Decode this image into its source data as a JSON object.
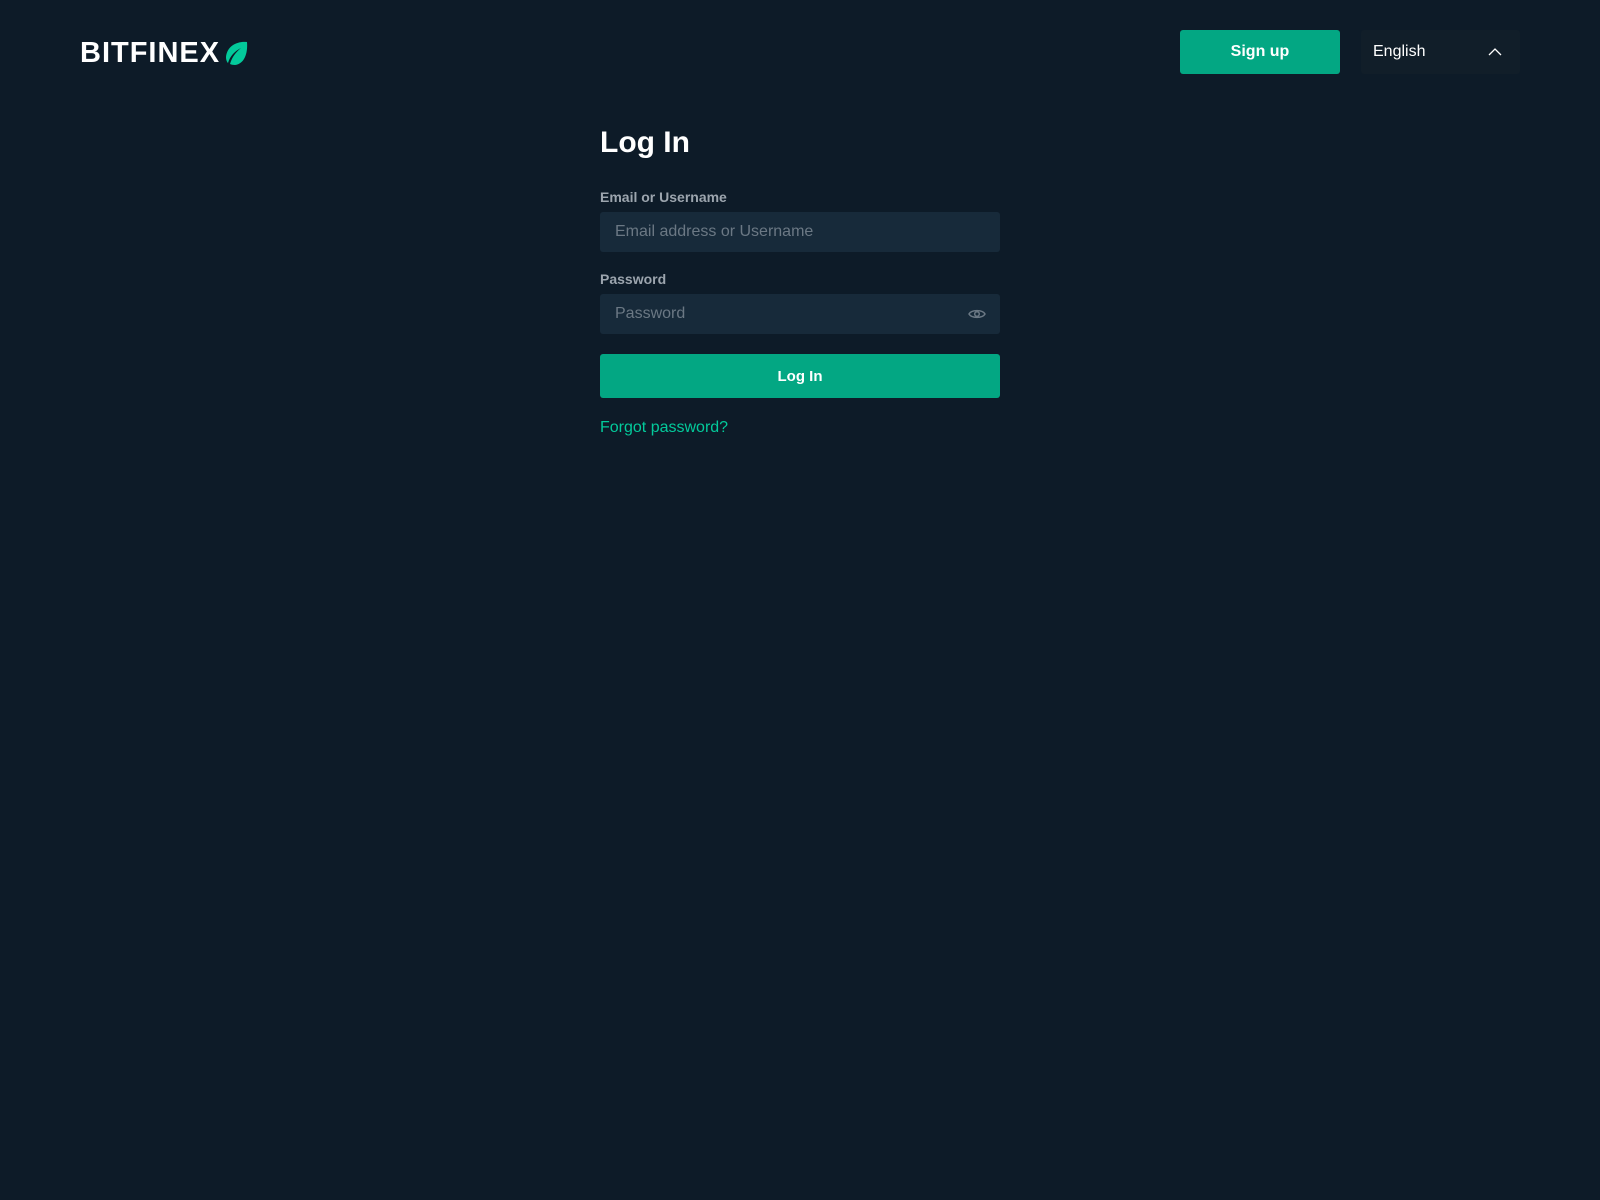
{
  "header": {
    "logo_text": "BITFINEX",
    "signup_label": "Sign up",
    "language": {
      "selected": "English",
      "icon": "chevron-up-icon"
    }
  },
  "login": {
    "title": "Log In",
    "email": {
      "label": "Email or Username",
      "placeholder": "Email address or Username",
      "value": ""
    },
    "password": {
      "label": "Password",
      "placeholder": "Password",
      "value": "",
      "toggle_icon": "eye-icon"
    },
    "submit_label": "Log In",
    "forgot_label": "Forgot password?"
  },
  "colors": {
    "background": "#0d1b28",
    "accent": "#03a783",
    "link": "#03ca9b",
    "input_bg": "#172a3a"
  }
}
